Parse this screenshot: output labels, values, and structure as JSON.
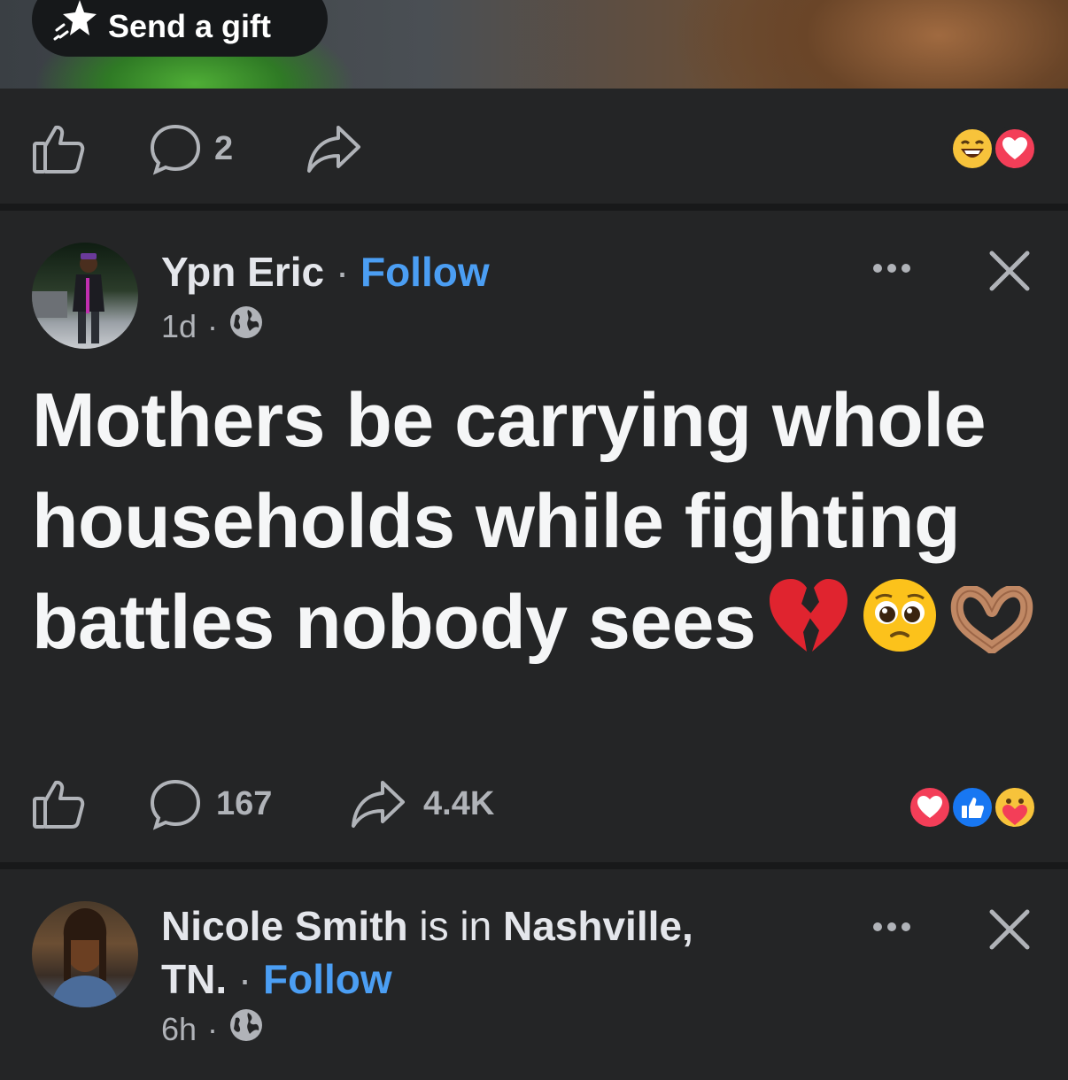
{
  "gift": {
    "label": "Send a gift",
    "icon": "sparkle-gift-icon"
  },
  "post_prev": {
    "comment_count": "2",
    "reactions": [
      "laughing-face-icon",
      "heart-reaction-icon"
    ]
  },
  "post1": {
    "author": "Ypn Eric",
    "separator": "·",
    "follow_label": "Follow",
    "time": "1d",
    "meta_separator": "·",
    "audience_icon": "globe-icon",
    "text": "Mothers be carrying whole households while fighting battles nobody sees",
    "emojis": [
      "broken-heart",
      "pleading-face",
      "heart-hands"
    ],
    "comment_count": "167",
    "share_count": "4.4K",
    "reactions": [
      "heart-reaction-icon",
      "like-reaction-icon",
      "care-reaction-icon"
    ],
    "colors": {
      "follow": "#4b9ef3",
      "heart": "#f33e58",
      "like": "#1877f2"
    }
  },
  "post2": {
    "author": "Nicole Smith",
    "location_prefix": "is in",
    "location": "Nashville,",
    "location_cont": "TN.",
    "separator": "·",
    "follow_label": "Follow",
    "time": "6h",
    "meta_separator": "·",
    "audience_icon": "globe-icon"
  }
}
